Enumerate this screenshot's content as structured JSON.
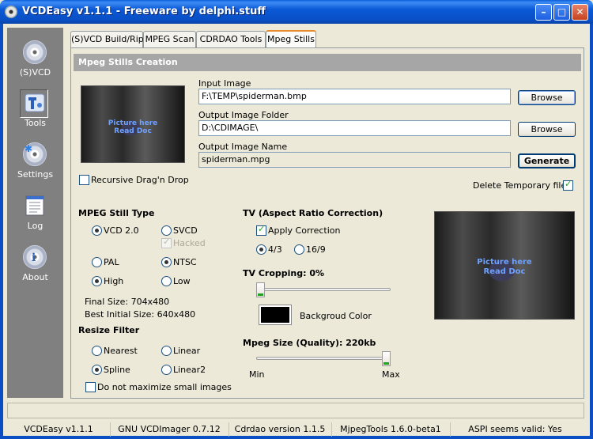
{
  "window": {
    "title": "VCDEasy v1.1.1 - Freeware by delphi.stuff"
  },
  "sidebar": {
    "items": [
      {
        "label": "(S)VCD",
        "icon": "cd-icon"
      },
      {
        "label": "Tools",
        "icon": "tools-icon"
      },
      {
        "label": "Settings",
        "icon": "settings-icon"
      },
      {
        "label": "Log",
        "icon": "log-icon"
      },
      {
        "label": "About",
        "icon": "info-icon"
      }
    ]
  },
  "tabs": [
    {
      "label": "(S)VCD Build/Rip"
    },
    {
      "label": "MPEG Scan"
    },
    {
      "label": "CDRDAO Tools"
    },
    {
      "label": "Mpeg Stills",
      "active": true
    }
  ],
  "panel": {
    "title": "Mpeg Stills Creation",
    "input_image": {
      "label": "Input Image",
      "value": "F:\\TEMP\\spiderman.bmp",
      "button": "Browse"
    },
    "output_folder": {
      "label": "Output Image Folder",
      "value": "D:\\CDIMAGE\\",
      "button": "Browse"
    },
    "output_name": {
      "label": "Output Image Name",
      "value": "spiderman.mpg",
      "button": "Generate"
    },
    "preview_watermark": [
      "Picture here",
      "Read Doc"
    ],
    "recursive_drag": {
      "label": "Recursive Drag'n Drop",
      "checked": false
    },
    "delete_temp": {
      "label": "Delete Temporary files",
      "checked": true
    },
    "still_type": {
      "heading": "MPEG Still Type",
      "vcd": "VCD 2.0",
      "svcd": "SVCD",
      "hacked": "Hacked",
      "pal": "PAL",
      "ntsc": "NTSC",
      "high": "High",
      "low": "Low",
      "final_size": "Final Size: 704x480",
      "best_initial": "Best Initial Size: 640x480"
    },
    "resize_filter": {
      "heading": "Resize Filter",
      "nearest": "Nearest",
      "linear": "Linear",
      "spline": "Spline",
      "linear2": "Linear2",
      "no_max": "Do not maximize small images"
    },
    "tv": {
      "heading": "TV (Aspect Ratio Correction)",
      "apply": "Apply Correction",
      "r43": "4/3",
      "r169": "16/9",
      "cropping": "TV Cropping: 0%",
      "cropping_value": 0,
      "bg_color_label": "Backgroud Color",
      "bg_color": "#000000"
    },
    "mpeg_size": {
      "heading": "Mpeg Size (Quality): 220kb",
      "min": "Min",
      "max": "Max",
      "value_fraction": 1.0
    }
  },
  "statusbar": [
    "VCDEasy v1.1.1",
    "GNU VCDImager 0.7.12",
    "Cdrdao version 1.1.5",
    "MjpegTools 1.6.0-beta1",
    "ASPI seems valid: Yes"
  ]
}
